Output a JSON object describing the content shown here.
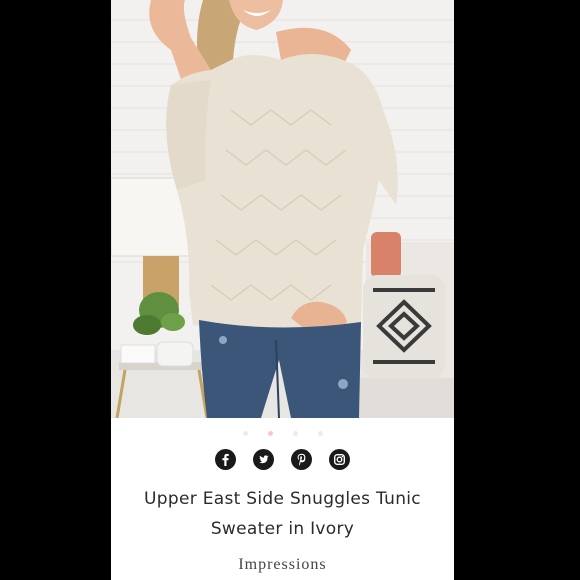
{
  "product": {
    "title": "Upper East Side Snuggles Tunic Sweater in Ivory",
    "brand": "Impressions"
  },
  "carousel": {
    "dot_count": 4,
    "active_index": 1
  },
  "social": [
    {
      "name": "facebook-icon",
      "glyph": "f"
    },
    {
      "name": "twitter-icon",
      "glyph": "t"
    },
    {
      "name": "pinterest-icon",
      "glyph": "p"
    },
    {
      "name": "instagram-icon",
      "glyph": "ig"
    }
  ],
  "colors": {
    "page_bg": "#000000",
    "card_bg": "#ffffff",
    "active_dot": "#f3c9cf",
    "inactive_dot": "#ececec",
    "icon": "#1a1a1a",
    "sweater": "#e9e1d4",
    "denim": "#3b5679"
  }
}
